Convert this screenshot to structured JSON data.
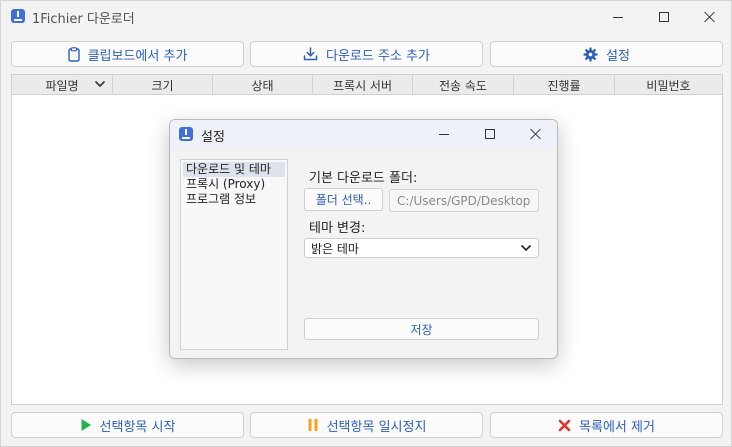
{
  "window": {
    "title": "1Fichier 다운로더"
  },
  "toolbar": {
    "paste_label": "클립보드에서 추가",
    "add_url_label": "다운로드 주소 추가",
    "settings_label": "설정"
  },
  "table": {
    "columns": [
      "파일명",
      "크기",
      "상태",
      "프록시 서버",
      "전송 속도",
      "진행률",
      "비밀번호"
    ]
  },
  "bottom": {
    "start_label": "선택항목 시작",
    "pause_label": "선택항목 일시정지",
    "remove_label": "목록에서 제거"
  },
  "settings_dialog": {
    "title": "설정",
    "nav": [
      "다운로드 및 테마",
      "프록시 (Proxy)",
      "프로그램 정보"
    ],
    "selected_nav_index": 0,
    "folder_label": "기본 다운로드 폴더:",
    "folder_button": "폴더 선택..",
    "folder_path": "C:/Users/GPD/Desktop",
    "theme_label": "테마 변경:",
    "theme_value": "밝은 테마",
    "save_label": "저장"
  },
  "colors": {
    "accent_text": "#2b5fb8",
    "play_icon": "#22b14c",
    "pause_icon": "#f7a21b",
    "remove_icon": "#e0332b",
    "gear_icon": "#2b5fb8"
  }
}
